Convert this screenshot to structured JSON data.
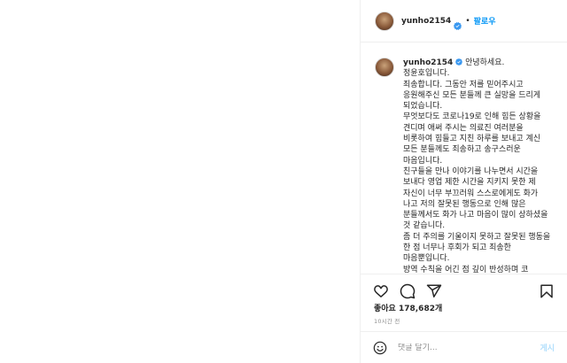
{
  "post": {
    "username": "yunho2154",
    "follow_separator": "•",
    "follow_label": "팔로우",
    "caption_lines": [
      "안녕하세요. 정윤호입니다.",
      "죄송합니다. 그동안 저를 믿어주시고 응원해주신 모든 분들께 큰 실망을 드리게 되었습니다.",
      "무엇보다도 코로나19로 인해 힘든 상황을 견디며 애써 주시는 의료진 여러분을 비롯하여 힘들고 지친 하루를 보내고 계신 모든 분들께도 죄송하고 송구스러운 마음입니다.",
      "친구들을 만나 이야기를 나누면서 시간을 보내다 영업 제한 시간을 지키지 못한 제 자신이 너무 부끄러워 스스로에게도 화가 나고 저의 잘못된 행동으로 인해 많은 분들께서도 화가 나고 마음이 많이 상하셨을 것 같습니다.",
      "좀 더 주의를 기울이지 못하고 잘못된 행동을 한 점 너무나 후회가 되고 죄송한 마음뿐입니다.",
      "방역 수칙을 어긴 점 깊이 반성하며 코"
    ],
    "likes_text": "좋아요 178,682개",
    "time_text": "10시간 전",
    "comment_placeholder": "댓글 달기...",
    "post_label": "게시"
  },
  "icons": {
    "verified": "verified-badge-icon",
    "like": "heart-icon",
    "comment": "comment-icon",
    "share": "paper-plane-icon",
    "save": "bookmark-icon",
    "emoji": "emoji-smile-icon"
  },
  "colors": {
    "verified": "#3897f0",
    "follow": "#0095f6",
    "post_disabled": "#b2dffc",
    "muted": "#8e8e8e",
    "border": "#efefef"
  }
}
